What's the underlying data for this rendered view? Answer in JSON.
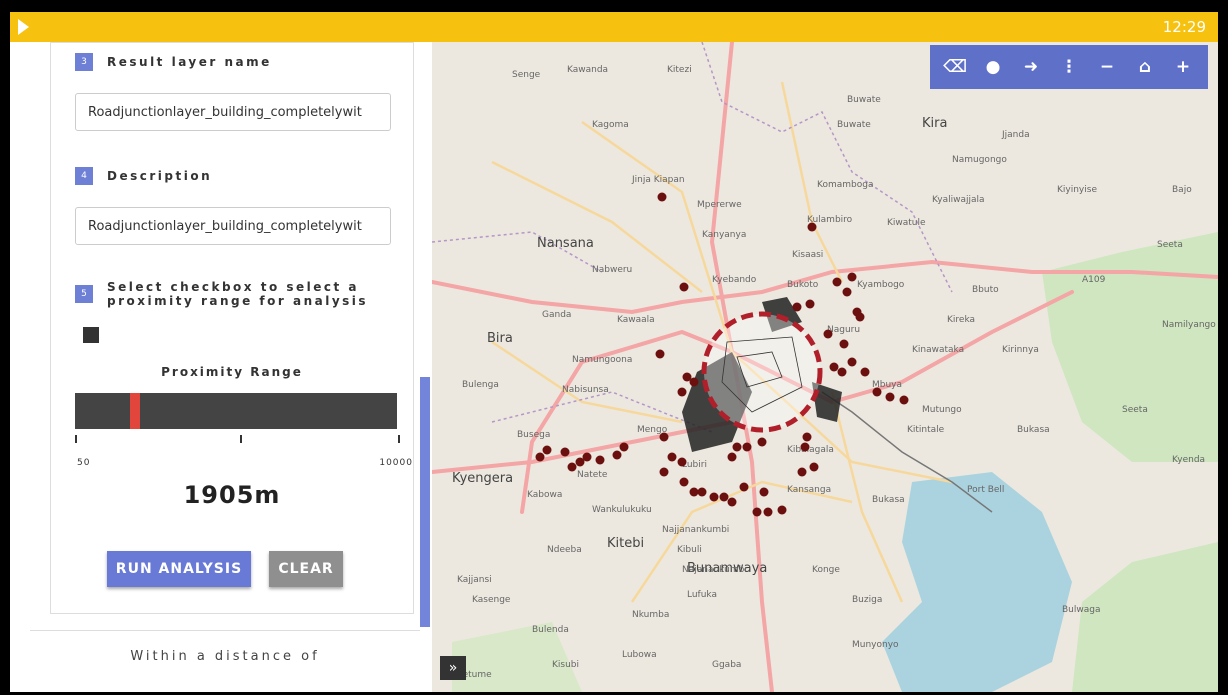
{
  "topbar": {
    "clock": "12:29"
  },
  "form": {
    "step3": {
      "number": "3",
      "label": "Result layer name",
      "value": "Roadjunctionlayer_building_completelywit"
    },
    "step4": {
      "number": "4",
      "label": "Description",
      "value": "Roadjunctionlayer_building_completelywit"
    },
    "step5": {
      "number": "5",
      "label_line1": "Select checkbox to select a",
      "label_line2": "proximity range for analysis"
    },
    "proximity": {
      "title": "Proximity Range",
      "min_label": "50",
      "max_label": "10000",
      "value": 1905,
      "value_label": "1905m"
    },
    "run_label": "RUN ANALYSIS",
    "clear_label": "CLEAR",
    "within_label": "Within a distance of"
  },
  "map": {
    "toolbar_icons": [
      "eraser-icon",
      "map-pin-icon",
      "exit-icon",
      "more-vertical-icon",
      "zoom-out-icon",
      "home-icon",
      "zoom-in-icon"
    ],
    "expand_label": "»",
    "places": [
      {
        "name": "Senge"
      },
      {
        "name": "Kawanda"
      },
      {
        "name": "Kitezi"
      },
      {
        "name": "Buwate"
      },
      {
        "name": "Kagoma"
      },
      {
        "name": "Buwate"
      },
      {
        "name": "Kira"
      },
      {
        "name": "Jjanda"
      },
      {
        "name": "Namugongo"
      },
      {
        "name": "Jinja Kiapan"
      },
      {
        "name": "Komamboga"
      },
      {
        "name": "Kiyinyise"
      },
      {
        "name": "Bajo"
      },
      {
        "name": "Mpererwe"
      },
      {
        "name": "Kyaliwajjala"
      },
      {
        "name": "Kulambiro"
      },
      {
        "name": "Kiwatule"
      },
      {
        "name": "Kanyanya"
      },
      {
        "name": "Nansana"
      },
      {
        "name": "Seeta"
      },
      {
        "name": "Kisaasi"
      },
      {
        "name": "Nabweru"
      },
      {
        "name": "Kyebando"
      },
      {
        "name": "Bukoto"
      },
      {
        "name": "Kyambogo"
      },
      {
        "name": "Bbuto"
      },
      {
        "name": "A109"
      },
      {
        "name": "Ganda"
      },
      {
        "name": "Kawaala"
      },
      {
        "name": "Naguru"
      },
      {
        "name": "Kireka"
      },
      {
        "name": "Namilyango"
      },
      {
        "name": "Bira"
      },
      {
        "name": "Namungoona"
      },
      {
        "name": "Kinawataka"
      },
      {
        "name": "Kirinnya"
      },
      {
        "name": "Bulenga"
      },
      {
        "name": "Nabisunsa"
      },
      {
        "name": "Mbuya"
      },
      {
        "name": "Mutungo"
      },
      {
        "name": "Kitintale"
      },
      {
        "name": "Bukasa"
      },
      {
        "name": "Seeta"
      },
      {
        "name": "Kyenda"
      },
      {
        "name": "Busega"
      },
      {
        "name": "Mengo"
      },
      {
        "name": "Kibalagala"
      },
      {
        "name": "Kyengera"
      },
      {
        "name": "Natete"
      },
      {
        "name": "Lubiri"
      },
      {
        "name": "Kabowa"
      },
      {
        "name": "Kansanga"
      },
      {
        "name": "Bukasa"
      },
      {
        "name": "Port Bell"
      },
      {
        "name": "Wankulukuku"
      },
      {
        "name": "Najjanankumbi"
      },
      {
        "name": "Kibuli"
      },
      {
        "name": "Kitebi"
      },
      {
        "name": "Ndeeba"
      },
      {
        "name": "Bunamwaya"
      },
      {
        "name": "Najanankumbi"
      },
      {
        "name": "Konge"
      },
      {
        "name": "Kajjansi"
      },
      {
        "name": "Lufuka"
      },
      {
        "name": "Buziga"
      },
      {
        "name": "Kasenge"
      },
      {
        "name": "Nkumba"
      },
      {
        "name": "Bulenda"
      },
      {
        "name": "Munyonyo"
      },
      {
        "name": "Lubowa"
      },
      {
        "name": "Ggaba"
      },
      {
        "name": "Kisubi"
      },
      {
        "name": "Kyetume"
      },
      {
        "name": "Bulwaga"
      }
    ]
  },
  "colors": {
    "topbar": "#f6c20f",
    "accent": "#6879d6",
    "slider_thumb": "#e2453b",
    "buffer": "#b01f2a",
    "points": "#6b0f0f"
  }
}
